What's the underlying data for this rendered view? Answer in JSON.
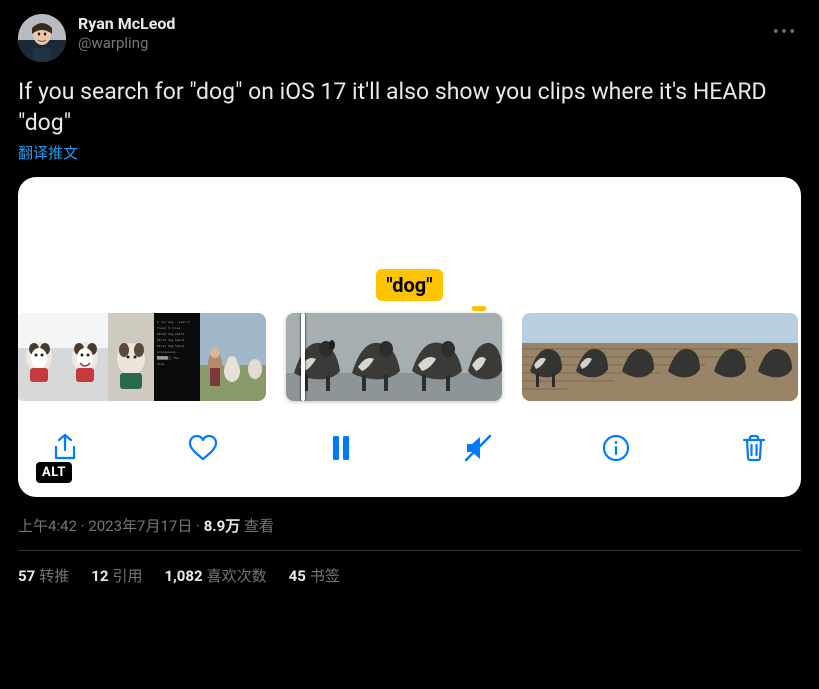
{
  "author": {
    "display_name": "Ryan McLeod",
    "handle": "@warpling"
  },
  "tweet_text": "If you search for \"dog\" on iOS 17 it'll also show you clips where it's HEARD \"dog\"",
  "translate_label": "翻译推文",
  "media": {
    "search_token": "\"dog\"",
    "alt_badge": "ALT"
  },
  "meta": {
    "time": "上午4:42",
    "separator1": " · ",
    "date": "2023年7月17日",
    "separator2": " · ",
    "views_count": "8.9万",
    "views_label": " 查看"
  },
  "stats": {
    "retweets": {
      "count": "57",
      "label": "转推"
    },
    "quotes": {
      "count": "12",
      "label": "引用"
    },
    "likes": {
      "count": "1,082",
      "label": "喜欢次数"
    },
    "bookmarks": {
      "count": "45",
      "label": "书签"
    }
  }
}
